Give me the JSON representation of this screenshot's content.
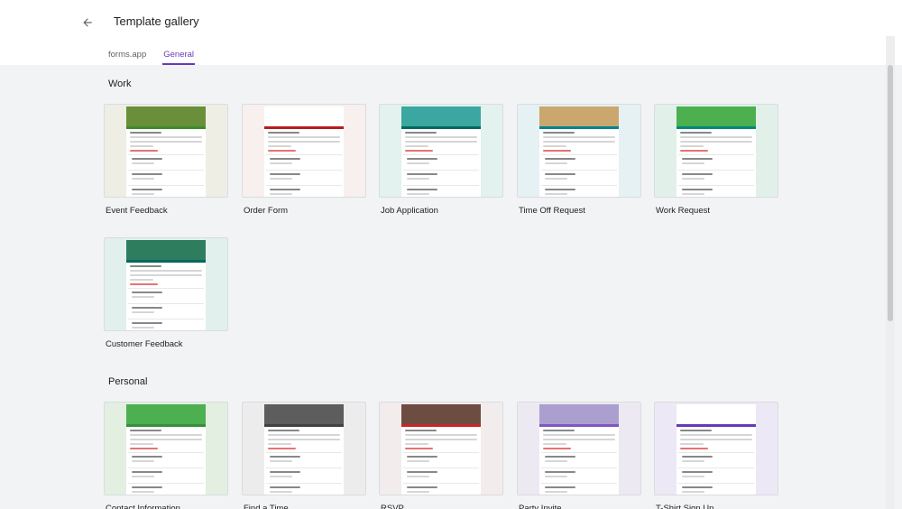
{
  "header": {
    "title": "Template gallery",
    "back_icon": "arrow-back-icon"
  },
  "tabs": [
    {
      "label": "forms.app",
      "active": false
    },
    {
      "label": "General",
      "active": true
    }
  ],
  "sections": [
    {
      "title": "Work",
      "templates": [
        {
          "label": "Event Feedback",
          "bg": "#eeeee5",
          "accent": "#3c8d2f",
          "banner": "#6a8f3a"
        },
        {
          "label": "Order Form",
          "bg": "#f7f0ee",
          "accent": "#b71c1c",
          "banner": "#ffffff"
        },
        {
          "label": "Job Application",
          "bg": "#e3f1ef",
          "accent": "#00695c",
          "banner": "#3aa7a0"
        },
        {
          "label": "Time Off Request",
          "bg": "#e6f1f4",
          "accent": "#00838f",
          "banner": "#c9a76e"
        },
        {
          "label": "Work Request",
          "bg": "#e1f1ea",
          "accent": "#00897b",
          "banner": "#4caf50"
        }
      ]
    },
    {
      "title": "",
      "templates": [
        {
          "label": "Customer Feedback",
          "bg": "#e2f0ed",
          "accent": "#00695c",
          "banner": "#2e7d5f"
        }
      ]
    },
    {
      "title": "Personal",
      "templates": [
        {
          "label": "Contact Information",
          "bg": "#e3efe1",
          "accent": "#388e3c",
          "banner": "#4caf50"
        },
        {
          "label": "Find a Time",
          "bg": "#ececec",
          "accent": "#424242",
          "banner": "#5d5d5d"
        },
        {
          "label": "RSVP",
          "bg": "#f3ecec",
          "accent": "#c62828",
          "banner": "#6d4c41"
        },
        {
          "label": "Party Invite",
          "bg": "#ece9f2",
          "accent": "#7e57c2",
          "banner": "#ab9fd0"
        },
        {
          "label": "T-Shirt Sign Up",
          "bg": "#ece8f5",
          "accent": "#673ab7",
          "banner": "#ffffff"
        }
      ]
    }
  ]
}
